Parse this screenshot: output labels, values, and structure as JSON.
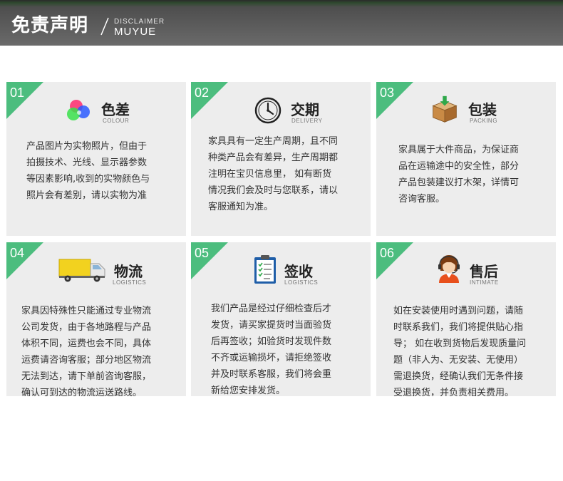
{
  "header": {
    "title": "免责声明",
    "sub1": "DISCLAIMER",
    "sub2": "MUYUE"
  },
  "accent_color": "#4cbd7e",
  "cards": [
    {
      "num": "01",
      "icon": "color-circles-icon",
      "title": "色差",
      "subtitle": "COLOUR",
      "lines": [
        "产品图片为实物照片，但由于",
        "拍摄技术、光线、显示器参数",
        "等因素影响,收到的实物颜色与",
        "照片会有差别，请以实物为准"
      ]
    },
    {
      "num": "02",
      "icon": "clock-icon",
      "title": "交期",
      "subtitle": "DELIVERY",
      "lines": [
        "家具具有一定生产周期，且不同",
        "种类产品会有差异，生产周期都",
        "注明在宝贝信息里，  如有断货",
        "情况我们会及时与您联系，请以",
        "客服通知为准。"
      ]
    },
    {
      "num": "03",
      "icon": "package-box-icon",
      "title": "包装",
      "subtitle": "PACKING",
      "lines": [
        "家具属于大件商品，为保证商",
        "品在运输途中的安全性，部分",
        "产品包装建议打木架，详情可",
        "咨询客服。"
      ]
    },
    {
      "num": "04",
      "icon": "truck-icon",
      "title": "物流",
      "subtitle": "LOGISTICS",
      "lines": [
        "家具因特殊性只能通过专业物流",
        "公司发货，由于各地路程与产品",
        "体积不同，运费也会不同，具体",
        "运费请咨询客服；部分地区物流",
        "无法到达，请下单前咨询客服，",
        "确认可到达的物流运送路线。"
      ]
    },
    {
      "num": "05",
      "icon": "clipboard-checklist-icon",
      "title": "签收",
      "subtitle": "LOGISTICS",
      "lines": [
        "我们产品是经过仔细检查后才",
        "发货，请买家提货时当面验货",
        "后再签收；如验货时发现件数",
        "不齐或运输损坏，请拒绝签收",
        "并及时联系客服，我们将会重",
        "新给您安排发货。"
      ]
    },
    {
      "num": "06",
      "icon": "customer-service-agent-icon",
      "title": "售后",
      "subtitle": "INTIMATE",
      "lines": [
        "如在安装使用时遇到问题，请随",
        "时联系我们，我们将提供贴心指",
        "导；   如在收到货物后发现质量问",
        "题（非人为、无安装、无使用）",
        "需退换货，经确认我们无条件接",
        "受退换货，并负责相关费用。"
      ]
    }
  ]
}
